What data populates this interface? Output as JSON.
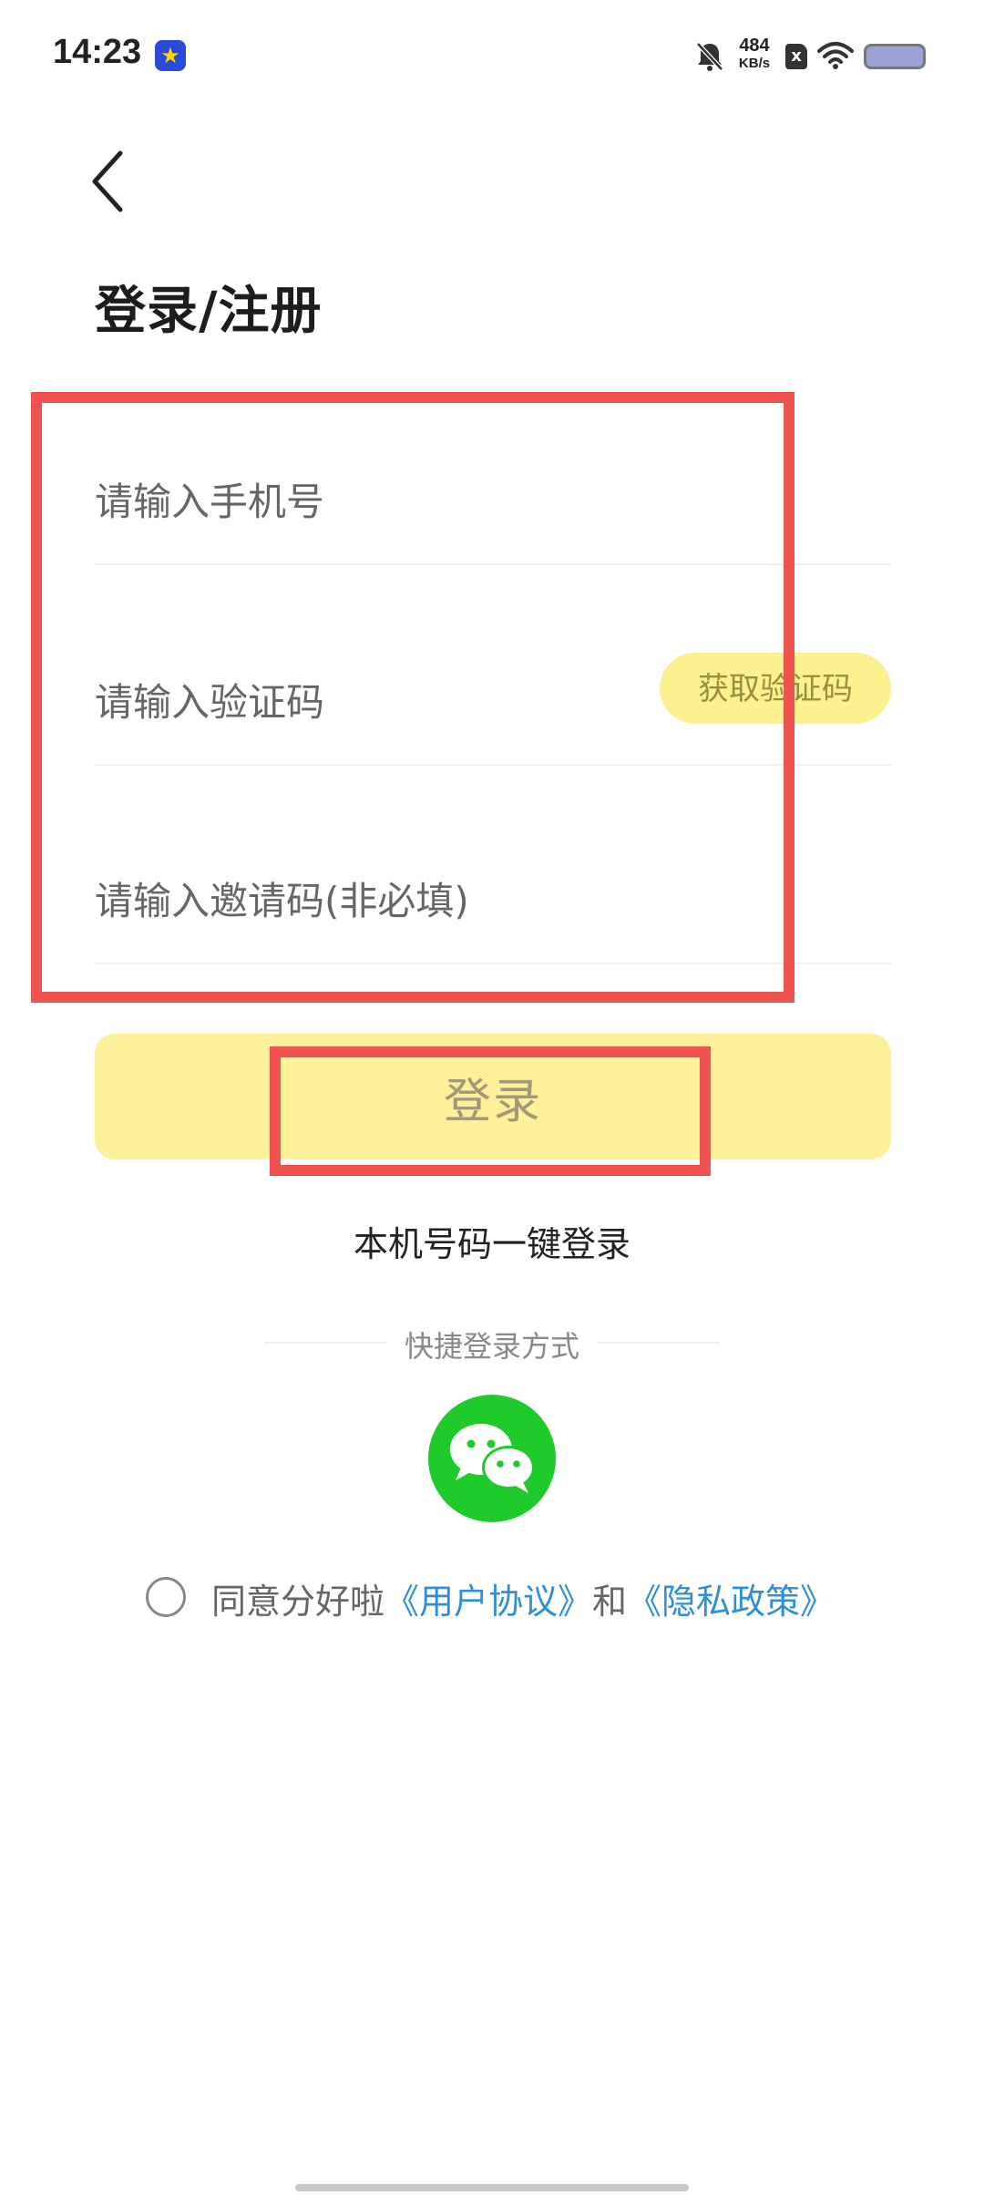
{
  "status_bar": {
    "time": "14:23",
    "app_icon": "star-app-icon",
    "net_speed_value": "484",
    "net_speed_unit": "KB/s",
    "sim_label": "x",
    "icons": [
      "bell-muted-icon",
      "sim-icon",
      "wifi-icon",
      "battery-icon"
    ]
  },
  "header": {
    "back_icon": "chevron-left-icon",
    "title": "登录/注册"
  },
  "form": {
    "phone_placeholder": "请输入手机号",
    "code_placeholder": "请输入验证码",
    "get_code_label": "获取验证码",
    "invite_placeholder": "请输入邀请码(非必填)"
  },
  "actions": {
    "login_label": "登录",
    "one_key_login": "本机号码一键登录"
  },
  "quick_login": {
    "title": "快捷登录方式",
    "wechat_icon": "wechat-icon"
  },
  "agreement": {
    "prefix": "同意分好啦",
    "user_agreement": "《用户协议》",
    "conjunction": "和",
    "privacy_policy": "《隐私政策》"
  },
  "colors": {
    "accent_yellow": "#fef09a",
    "highlight_red": "#ef5350",
    "wechat_green": "#1ecb2a",
    "link_blue": "#2f8fd6"
  }
}
